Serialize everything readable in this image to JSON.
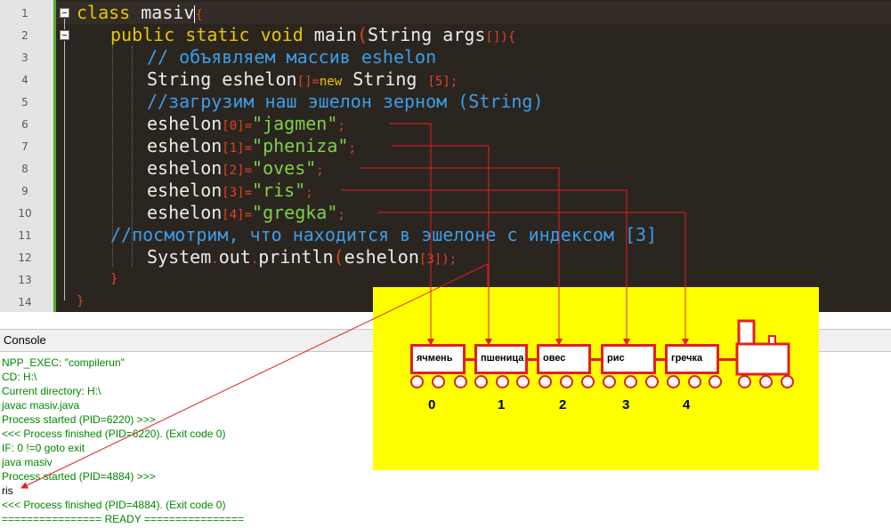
{
  "editor": {
    "line_numbers": [
      "1",
      "2",
      "3",
      "4",
      "5",
      "6",
      "7",
      "8",
      "9",
      "10",
      "11",
      "12",
      "13",
      "14"
    ],
    "code": {
      "l1": {
        "kw": "class",
        "name": " masiv",
        "brace": "{"
      },
      "l2": {
        "mods": "public static void",
        "name": " main",
        "open": "(",
        "type": "String",
        "arg": " args",
        "arr": "[]",
        "close": "){"
      },
      "l3": {
        "comment": "// объявляем массив eshelon"
      },
      "l4": {
        "type": "String",
        "name": " eshelon",
        "arr": "[]",
        "eq": "=",
        "kwnew": "new",
        "type2": " String ",
        "size": "[5]",
        "semi": ";"
      },
      "l5": {
        "comment": "//загрузим наш эшелон зерном (String)"
      },
      "assign": [
        {
          "var": "eshelon",
          "idx": "[0]",
          "eq": "=",
          "value": "\"jagmen\"",
          "semi": ";"
        },
        {
          "var": "eshelon",
          "idx": "[1]",
          "eq": "=",
          "value": "\"pheniza\"",
          "semi": ";"
        },
        {
          "var": "eshelon",
          "idx": "[2]",
          "eq": "=",
          "value": "\"oves\"",
          "semi": ";"
        },
        {
          "var": "eshelon",
          "idx": "[3]",
          "eq": "=",
          "value": "\"ris\"",
          "semi": ";"
        },
        {
          "var": "eshelon",
          "idx": "[4]",
          "eq": "=",
          "value": "\"gregka\"",
          "semi": ";"
        }
      ],
      "l11": {
        "comment": "//посмотрим, что находится в эшелоне с индексом [3]"
      },
      "l12": {
        "sys": "System",
        "dot1": ".",
        "out": "out",
        "dot2": ".",
        "println": "println",
        "open": "(",
        "var": "eshelon",
        "idx": "[3]",
        "close": ");"
      },
      "l13": {
        "brace": "}"
      },
      "l14": {
        "brace": "}"
      }
    }
  },
  "console": {
    "title": "Console",
    "lines": [
      "NPP_EXEC: \"compilerun\"",
      "CD: H:\\",
      "Current directory: H:\\",
      "javac masiv.java",
      "Process started (PID=6220) >>>",
      "<<< Process finished (PID=6220). (Exit code 0)",
      "IF: 0 !=0 goto exit",
      "java masiv",
      "Process started (PID=4884) >>>",
      "ris",
      "<<< Process finished (PID=4884). (Exit code 0)",
      "================ READY ================"
    ]
  },
  "train": {
    "wagons": [
      "ячмень",
      "пшеница",
      "овес",
      "рис",
      "гречка"
    ],
    "indices": [
      "0",
      "1",
      "2",
      "3",
      "4"
    ]
  },
  "colors": {
    "editor_bg": "#2b2520",
    "keyword": "#e6c800",
    "string": "#7fd14a",
    "comment": "#3b9ee8",
    "punct": "#dd4422",
    "console_text": "#008800",
    "panel_bg": "#ffff00",
    "arrow": "#e02020"
  }
}
